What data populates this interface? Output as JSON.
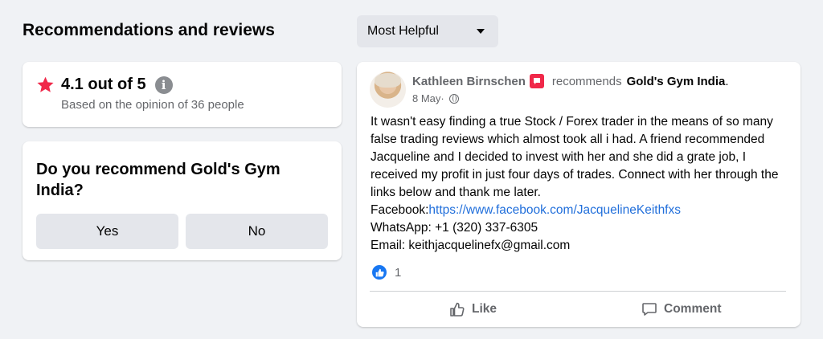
{
  "section": {
    "title": "Recommendations and reviews",
    "sort_label": "Most Helpful"
  },
  "rating": {
    "score_text": "4.1 out of 5",
    "subtitle": "Based on the opinion of 36 people",
    "info_icon": "i"
  },
  "recommend": {
    "question": "Do you recommend Gold's Gym India?",
    "yes_label": "Yes",
    "no_label": "No"
  },
  "post": {
    "author": "Kathleen Birnschen",
    "verb": "recommends",
    "page": "Gold's Gym India",
    "period": ".",
    "date": "8 May",
    "date_sep": " ·",
    "body_intro": "It wasn't easy finding a true Stock / Forex trader in the means of so many false trading reviews which almost took all i had. A friend recommended Jacqueline and I decided to invest with her and she did a grate job, I received my profit in just four days of trades. Connect with her through the links below and thank me later.",
    "facebook_label": "Facebook:",
    "facebook_link": "https://www.facebook.com/JacquelineKeithfxs",
    "whatsapp_line": "WhatsApp: +1 (320) 337-6305",
    "email_line": "Email: keithjacquelinefx@gmail.com",
    "like_count": "1",
    "like_action": "Like",
    "comment_action": "Comment"
  },
  "colors": {
    "accent": "#1877f2",
    "star": "#f02849",
    "link": "#216fdb",
    "background": "#f0f2f5"
  },
  "icons": [
    "star-icon",
    "info-icon",
    "chevron-down-icon",
    "recommend-badge-icon",
    "globe-icon",
    "like-reaction-icon",
    "thumbs-up-icon",
    "comment-icon"
  ]
}
